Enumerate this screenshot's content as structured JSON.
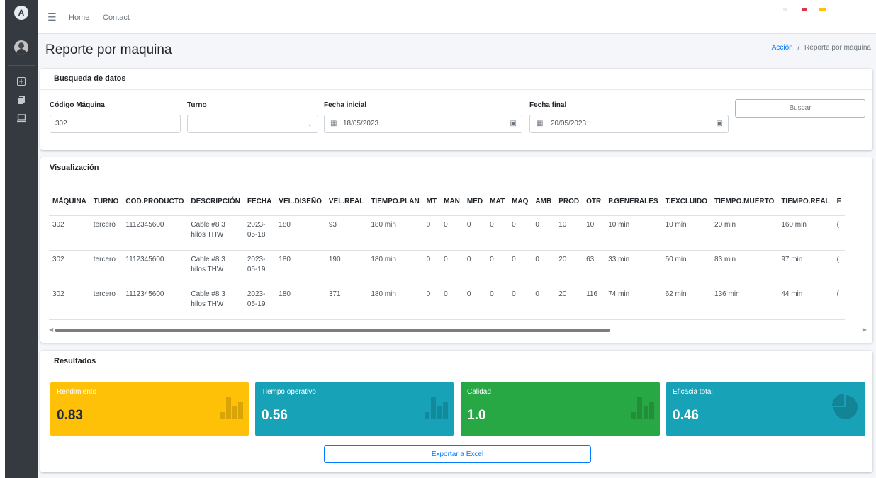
{
  "sidebar": {
    "logo": "A",
    "icons": [
      "grid-plus-icon",
      "copy-icon",
      "laptop-icon"
    ]
  },
  "navbar": {
    "links": [
      "Home",
      "Contact"
    ]
  },
  "page": {
    "title": "Reporte por maquina",
    "breadcrumb": {
      "link": "Acción",
      "sep": "/",
      "current": "Reporte por maquina"
    }
  },
  "search": {
    "title": "Busqueda de datos",
    "machine_label": "Código Máquina",
    "machine_value": "302",
    "shift_label": "Turno",
    "shift_value": "",
    "start_label": "Fecha inicial",
    "start_value": "18/05/2023",
    "end_label": "Fecha final",
    "end_value": "20/05/2023",
    "search_button": "Buscar"
  },
  "table": {
    "title": "Visualización",
    "headers": [
      "MÁQUINA",
      "TURNO",
      "COD.PRODUCTO",
      "DESCRIPCIÓN",
      "FECHA",
      "VEL.DISEÑO",
      "VEL.REAL",
      "TIEMPO.PLAN",
      "MT",
      "MAN",
      "MED",
      "MAT",
      "MAQ",
      "AMB",
      "PROD",
      "OTR",
      "P.GENERALES",
      "T.EXCLUIDO",
      "TIEMPO.MUERTO",
      "TIEMPO.REAL",
      "F"
    ],
    "rows": [
      [
        "302",
        "tercero",
        "1112345600",
        "Cable #8 3 hilos THW",
        "2023-05-18",
        "180",
        "93",
        "180 min",
        "0",
        "0",
        "0",
        "0",
        "0",
        "0",
        "10",
        "10",
        "10 min",
        "10 min",
        "20 min",
        "160 min",
        "("
      ],
      [
        "302",
        "tercero",
        "1112345600",
        "Cable #8 3 hilos THW",
        "2023-05-19",
        "180",
        "190",
        "180 min",
        "0",
        "0",
        "0",
        "0",
        "0",
        "0",
        "20",
        "63",
        "33 min",
        "50 min",
        "83 min",
        "97 min",
        "("
      ],
      [
        "302",
        "tercero",
        "1112345600",
        "Cable #8 3 hilos THW",
        "2023-05-19",
        "180",
        "371",
        "180 min",
        "0",
        "0",
        "0",
        "0",
        "0",
        "0",
        "20",
        "116",
        "74 min",
        "62 min",
        "136 min",
        "44 min",
        "("
      ]
    ]
  },
  "results": {
    "title": "Resultados",
    "kpis": [
      {
        "label": "Rendimiento",
        "value": "0.83",
        "color": "#ffc107",
        "icon": "bar-chart-icon"
      },
      {
        "label": "Tiempo operativo",
        "value": "0.56",
        "color": "#17a2b8",
        "icon": "bar-chart-icon"
      },
      {
        "label": "Calidad",
        "value": "1.0",
        "color": "#28a745",
        "icon": "bar-chart-icon"
      },
      {
        "label": "Eficacia total",
        "value": "0.46",
        "color": "#17a2b8",
        "icon": "pie-chart-icon"
      }
    ],
    "export_button": "Exportar a Excel"
  },
  "colors": {
    "sidebar": "#343a40",
    "primary": "#007bff",
    "background": "#f4f6f9"
  }
}
